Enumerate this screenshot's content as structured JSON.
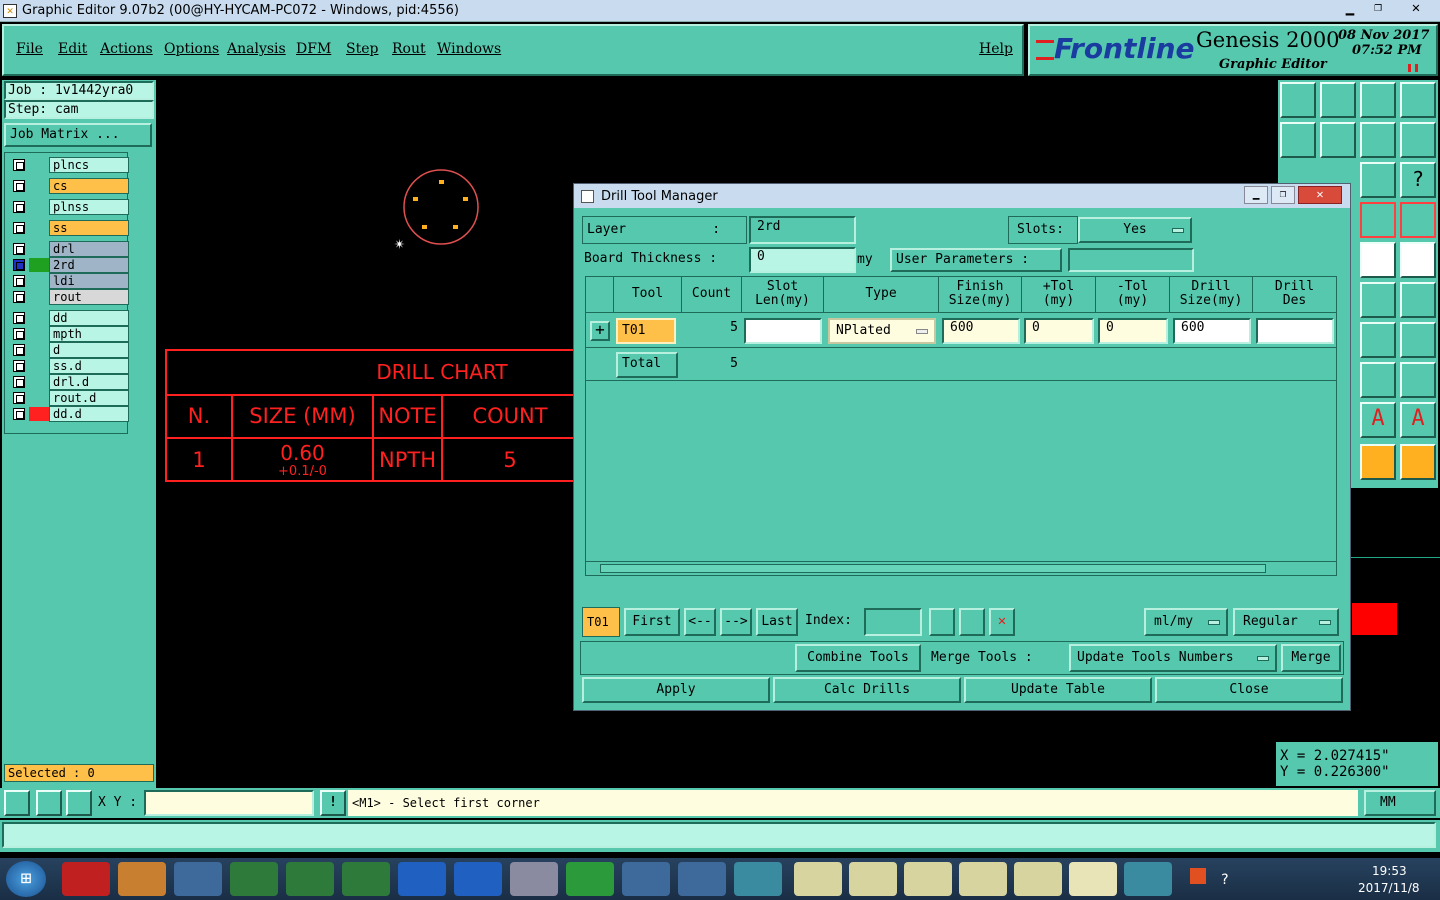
{
  "window": {
    "title": "Graphic Editor 9.07b2 (00@HY-HYCAM-PC072 - Windows, pid:4556)"
  },
  "menu": {
    "items": [
      "File",
      "Edit",
      "Actions",
      "Options",
      "Analysis",
      "DFM",
      "Step",
      "Rout",
      "Windows"
    ],
    "help": "Help"
  },
  "brand": {
    "logo": "Frontline",
    "product": "Genesis 2000",
    "subtitle": "Graphic Editor",
    "date": "08 Nov 2017",
    "time": "07:52 PM"
  },
  "job": {
    "job": "Job : 1v1442yra0",
    "step": "Step: cam",
    "matrix": "Job Matrix ..."
  },
  "layers": [
    {
      "name": "plncs",
      "color": "#b9f5e4"
    },
    {
      "name": "cs",
      "color": "#ffc04a"
    },
    {
      "name": "plnss",
      "color": "#b9f5e4"
    },
    {
      "name": "ss",
      "color": "#ffc04a"
    },
    {
      "name": "drl",
      "color": "#9fb5c7"
    },
    {
      "name": "2rd",
      "color": "#9fb5c7"
    },
    {
      "name": "ldi",
      "color": "#9fb5c7"
    },
    {
      "name": "rout",
      "color": "#d8d8d8"
    },
    {
      "name": "dd",
      "color": "#b9f5e4"
    },
    {
      "name": "mpth",
      "color": "#b9f5e4"
    },
    {
      "name": "d",
      "color": "#b9f5e4"
    },
    {
      "name": "ss.d",
      "color": "#b9f5e4"
    },
    {
      "name": "drl.d",
      "color": "#b9f5e4"
    },
    {
      "name": "rout.d",
      "color": "#b9f5e4"
    },
    {
      "name": "dd.d",
      "color": "#b9f5e4"
    }
  ],
  "selected": "Selected : 0",
  "coord": {
    "x": "X = 2.027415\"",
    "y": "Y = 0.226300\""
  },
  "status": {
    "xy_label": "X Y :",
    "prompt": "<M1> - Select first corner",
    "units": "MM"
  },
  "drill_chart": {
    "title": "DRILL CHART",
    "headers": [
      "N.",
      "SIZE (MM)",
      "NOTE",
      "COUNT"
    ],
    "row": [
      "1",
      "0.60",
      "NPTH",
      "5"
    ],
    "tol": "+0.1/-0"
  },
  "dialog": {
    "title": "Drill Tool Manager",
    "layer_label": "Layer           :",
    "layer_value": "2rd",
    "slots_label": "Slots:",
    "slots_value": "Yes",
    "thick_label": "Board Thickness :",
    "thick_value": "0",
    "thick_unit": "my",
    "user_params": "User Parameters :",
    "headers": [
      "Tool",
      "Count",
      "Slot\nLen(my)",
      "Type",
      "Finish\nSize(my)",
      "+Tol\n(my)",
      "-Tol\n(my)",
      "Drill\nSize(my)",
      "Drill\nDes"
    ],
    "row": {
      "tool": "T01",
      "count": "5",
      "type": "NPlated",
      "finish": "600",
      "ptol": "0",
      "mtol": "0",
      "drill": "600"
    },
    "total": {
      "label": "Total",
      "count": "5"
    },
    "nav": {
      "current": "T01",
      "first": "First",
      "prev": "<--",
      "next": "-->",
      "last": "Last",
      "index": "Index:",
      "units": "ml/my",
      "mode": "Regular"
    },
    "row2": {
      "combine": "Combine Tools",
      "merge_label": "Merge Tools :",
      "update_nums": "Update Tools Numbers",
      "merge": "Merge"
    },
    "actions": {
      "apply": "Apply",
      "calc": "Calc Drills",
      "update": "Update Table",
      "close": "Close"
    }
  },
  "toolbar_icons": [
    "r1",
    "r2"
  ],
  "tray": {
    "time": "19:53",
    "date": "2017/11/8"
  }
}
